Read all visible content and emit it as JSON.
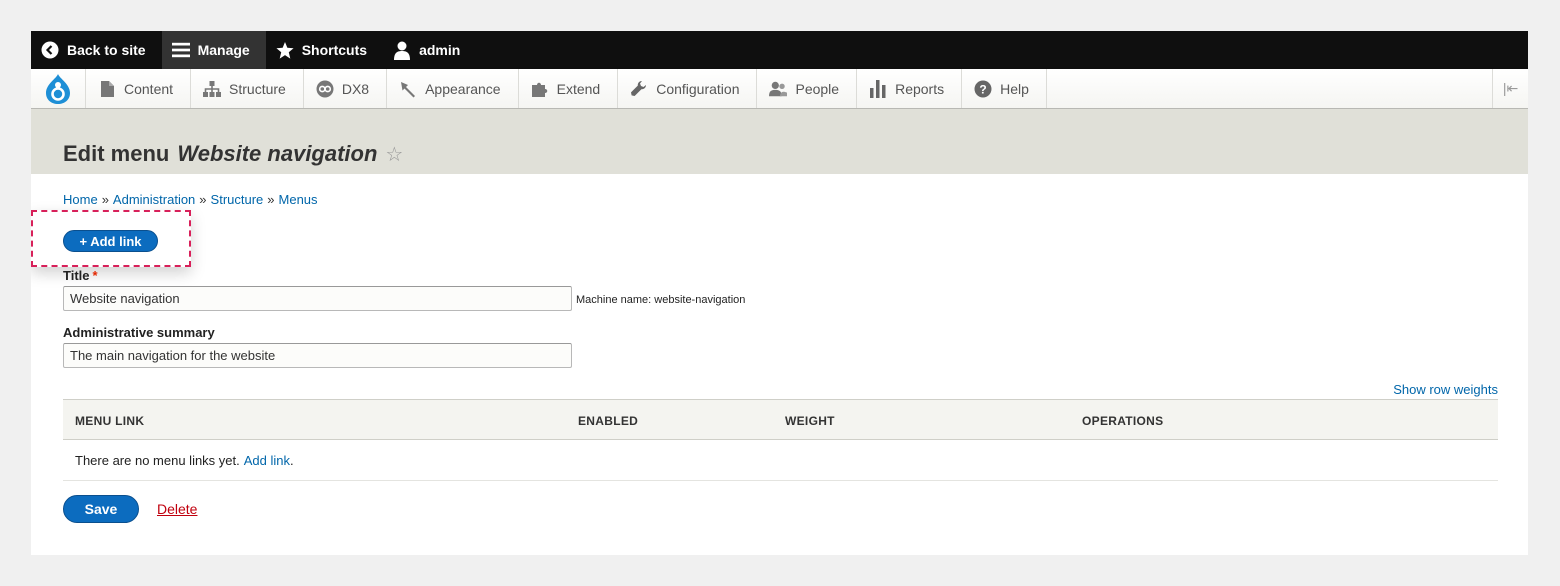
{
  "toolbar": {
    "back_label": "Back to site",
    "manage_label": "Manage",
    "shortcuts_label": "Shortcuts",
    "user_label": "admin"
  },
  "tray": {
    "items": [
      {
        "label": "Content",
        "icon": "file-icon"
      },
      {
        "label": "Structure",
        "icon": "sitemap-icon"
      },
      {
        "label": "DX8",
        "icon": "dx8-icon"
      },
      {
        "label": "Appearance",
        "icon": "paintbrush-icon"
      },
      {
        "label": "Extend",
        "icon": "puzzle-icon"
      },
      {
        "label": "Configuration",
        "icon": "wrench-icon"
      },
      {
        "label": "People",
        "icon": "people-icon"
      },
      {
        "label": "Reports",
        "icon": "bar-chart-icon"
      },
      {
        "label": "Help",
        "icon": "help-icon"
      }
    ],
    "toggle": "|⇤"
  },
  "page": {
    "title_prefix": "Edit menu",
    "title_name": "Website navigation",
    "star": "☆"
  },
  "breadcrumb": {
    "items": [
      "Home",
      "Administration",
      "Structure",
      "Menus"
    ],
    "separator": "»"
  },
  "actions": {
    "add_link": "+ Add link"
  },
  "form": {
    "title_label": "Title",
    "required_mark": "*",
    "title_value": "Website navigation",
    "machine_name": "Machine name: website-navigation",
    "summary_label": "Administrative summary",
    "summary_value": "The main navigation for the website",
    "show_row_weights": "Show row weights"
  },
  "table": {
    "headers": [
      "MENU LINK",
      "ENABLED",
      "WEIGHT",
      "OPERATIONS"
    ],
    "empty_text": "There are no menu links yet.",
    "empty_link": "Add link",
    "empty_suffix": "."
  },
  "buttons": {
    "save": "Save",
    "delete": "Delete"
  },
  "colors": {
    "accent": "#0c6cbf",
    "link": "#0066aa",
    "highlight": "#d8205a",
    "danger": "#c0000e"
  }
}
